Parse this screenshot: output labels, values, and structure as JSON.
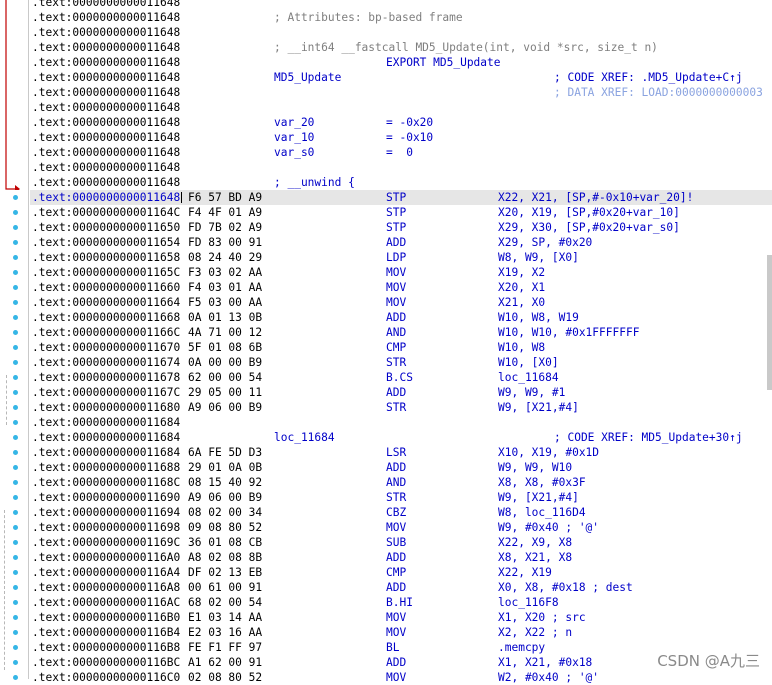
{
  "watermark": "CSDN @A九三",
  "rows": [
    {
      "addr": ".text:0000000000011648",
      "bytes": "",
      "lbl": "",
      "mnem": "",
      "ops": "",
      "cmtGray": "",
      "cmtBlue": "",
      "cmtLBlue": ""
    },
    {
      "addr": ".text:0000000000011648",
      "bytes": "",
      "lbl": "",
      "mnem": "",
      "ops": "",
      "cmtGray": "; Attributes: bp-based frame",
      "cmtBlue": "",
      "cmtLBlue": ""
    },
    {
      "addr": ".text:0000000000011648",
      "bytes": "",
      "lbl": "",
      "mnem": "",
      "ops": "",
      "cmtGray": "",
      "cmtBlue": "",
      "cmtLBlue": ""
    },
    {
      "addr": ".text:0000000000011648",
      "bytes": "",
      "lbl": "",
      "mnem": "",
      "ops": "",
      "cmtGray": "; __int64 __fastcall MD5_Update(int, void *src, size_t n)",
      "cmtBlue": "",
      "cmtLBlue": ""
    },
    {
      "addr": ".text:0000000000011648",
      "bytes": "",
      "lbl": "",
      "mnem": "EXPORT MD5_Update",
      "ops": "",
      "cmtGray": "",
      "cmtBlue": "",
      "cmtLBlue": ""
    },
    {
      "addr": ".text:0000000000011648",
      "bytes": "",
      "lbl": "MD5_Update",
      "mnem": "",
      "ops": "",
      "cmtGray": "",
      "cmtBlue": "; CODE XREF: .MD5_Update+C↑j",
      "cmtLBlue": ""
    },
    {
      "addr": ".text:0000000000011648",
      "bytes": "",
      "lbl": "",
      "mnem": "",
      "ops": "",
      "cmtGray": "",
      "cmtBlue": "",
      "cmtLBlue": "; DATA XREF: LOAD:0000000000003"
    },
    {
      "addr": ".text:0000000000011648",
      "bytes": "",
      "lbl": "",
      "mnem": "",
      "ops": "",
      "cmtGray": "",
      "cmtBlue": "",
      "cmtLBlue": ""
    },
    {
      "addr": ".text:0000000000011648",
      "bytes": "",
      "lbl": "var_20",
      "mnem": "= -0x20",
      "ops": "",
      "cmtGray": "",
      "cmtBlue": "",
      "cmtLBlue": ""
    },
    {
      "addr": ".text:0000000000011648",
      "bytes": "",
      "lbl": "var_10",
      "mnem": "= -0x10",
      "ops": "",
      "cmtGray": "",
      "cmtBlue": "",
      "cmtLBlue": ""
    },
    {
      "addr": ".text:0000000000011648",
      "bytes": "",
      "lbl": "var_s0",
      "mnem": "=  0",
      "ops": "",
      "cmtGray": "",
      "cmtBlue": "",
      "cmtLBlue": ""
    },
    {
      "addr": ".text:0000000000011648",
      "bytes": "",
      "lbl": "",
      "mnem": "",
      "ops": "",
      "cmtGray": "",
      "cmtBlue": "",
      "cmtLBlue": ""
    },
    {
      "addr": ".text:0000000000011648",
      "bytes": "",
      "lbl": "; __unwind {",
      "mnem": "",
      "ops": "",
      "cmtGray": "",
      "cmtBlue": "",
      "cmtLBlue": ""
    },
    {
      "addr": ".text:0000000000011648",
      "bytes": "F6 57 BD A9",
      "lbl": "",
      "mnem": "STP",
      "ops": "X22, X21, [SP,#-0x10+var_20]!",
      "cmtGray": "",
      "cmtBlue": "",
      "cmtLBlue": ""
    },
    {
      "addr": ".text:000000000001164C",
      "bytes": "F4 4F 01 A9",
      "lbl": "",
      "mnem": "STP",
      "ops": "X20, X19, [SP,#0x20+var_10]",
      "cmtGray": "",
      "cmtBlue": "",
      "cmtLBlue": ""
    },
    {
      "addr": ".text:0000000000011650",
      "bytes": "FD 7B 02 A9",
      "lbl": "",
      "mnem": "STP",
      "ops": "X29, X30, [SP,#0x20+var_s0]",
      "cmtGray": "",
      "cmtBlue": "",
      "cmtLBlue": ""
    },
    {
      "addr": ".text:0000000000011654",
      "bytes": "FD 83 00 91",
      "lbl": "",
      "mnem": "ADD",
      "ops": "X29, SP, #0x20",
      "cmtGray": "",
      "cmtBlue": "",
      "cmtLBlue": ""
    },
    {
      "addr": ".text:0000000000011658",
      "bytes": "08 24 40 29",
      "lbl": "",
      "mnem": "LDP",
      "ops": "W8, W9, [X0]",
      "cmtGray": "",
      "cmtBlue": "",
      "cmtLBlue": ""
    },
    {
      "addr": ".text:000000000001165C",
      "bytes": "F3 03 02 AA",
      "lbl": "",
      "mnem": "MOV",
      "ops": "X19, X2",
      "cmtGray": "",
      "cmtBlue": "",
      "cmtLBlue": ""
    },
    {
      "addr": ".text:0000000000011660",
      "bytes": "F4 03 01 AA",
      "lbl": "",
      "mnem": "MOV",
      "ops": "X20, X1",
      "cmtGray": "",
      "cmtBlue": "",
      "cmtLBlue": ""
    },
    {
      "addr": ".text:0000000000011664",
      "bytes": "F5 03 00 AA",
      "lbl": "",
      "mnem": "MOV",
      "ops": "X21, X0",
      "cmtGray": "",
      "cmtBlue": "",
      "cmtLBlue": ""
    },
    {
      "addr": ".text:0000000000011668",
      "bytes": "0A 01 13 0B",
      "lbl": "",
      "mnem": "ADD",
      "ops": "W10, W8, W19",
      "cmtGray": "",
      "cmtBlue": "",
      "cmtLBlue": ""
    },
    {
      "addr": ".text:000000000001166C",
      "bytes": "4A 71 00 12",
      "lbl": "",
      "mnem": "AND",
      "ops": "W10, W10, #0x1FFFFFFF",
      "cmtGray": "",
      "cmtBlue": "",
      "cmtLBlue": ""
    },
    {
      "addr": ".text:0000000000011670",
      "bytes": "5F 01 08 6B",
      "lbl": "",
      "mnem": "CMP",
      "ops": "W10, W8",
      "cmtGray": "",
      "cmtBlue": "",
      "cmtLBlue": ""
    },
    {
      "addr": ".text:0000000000011674",
      "bytes": "0A 00 00 B9",
      "lbl": "",
      "mnem": "STR",
      "ops": "W10, [X0]",
      "cmtGray": "",
      "cmtBlue": "",
      "cmtLBlue": ""
    },
    {
      "addr": ".text:0000000000011678",
      "bytes": "62 00 00 54",
      "lbl": "",
      "mnem": "B.CS",
      "ops": "loc_11684",
      "cmtGray": "",
      "cmtBlue": "",
      "cmtLBlue": ""
    },
    {
      "addr": ".text:000000000001167C",
      "bytes": "29 05 00 11",
      "lbl": "",
      "mnem": "ADD",
      "ops": "W9, W9, #1",
      "cmtGray": "",
      "cmtBlue": "",
      "cmtLBlue": ""
    },
    {
      "addr": ".text:0000000000011680",
      "bytes": "A9 06 00 B9",
      "lbl": "",
      "mnem": "STR",
      "ops": "W9, [X21,#4]",
      "cmtGray": "",
      "cmtBlue": "",
      "cmtLBlue": ""
    },
    {
      "addr": ".text:0000000000011684",
      "bytes": "",
      "lbl": "",
      "mnem": "",
      "ops": "",
      "cmtGray": "",
      "cmtBlue": "",
      "cmtLBlue": ""
    },
    {
      "addr": ".text:0000000000011684",
      "bytes": "",
      "lbl": "loc_11684",
      "mnem": "",
      "ops": "",
      "cmtGray": "",
      "cmtBlue": "; CODE XREF: MD5_Update+30↑j",
      "cmtLBlue": ""
    },
    {
      "addr": ".text:0000000000011684",
      "bytes": "6A FE 5D D3",
      "lbl": "",
      "mnem": "LSR",
      "ops": "X10, X19, #0x1D",
      "cmtGray": "",
      "cmtBlue": "",
      "cmtLBlue": ""
    },
    {
      "addr": ".text:0000000000011688",
      "bytes": "29 01 0A 0B",
      "lbl": "",
      "mnem": "ADD",
      "ops": "W9, W9, W10",
      "cmtGray": "",
      "cmtBlue": "",
      "cmtLBlue": ""
    },
    {
      "addr": ".text:000000000001168C",
      "bytes": "08 15 40 92",
      "lbl": "",
      "mnem": "AND",
      "ops": "X8, X8, #0x3F",
      "cmtGray": "",
      "cmtBlue": "",
      "cmtLBlue": ""
    },
    {
      "addr": ".text:0000000000011690",
      "bytes": "A9 06 00 B9",
      "lbl": "",
      "mnem": "STR",
      "ops": "W9, [X21,#4]",
      "cmtGray": "",
      "cmtBlue": "",
      "cmtLBlue": ""
    },
    {
      "addr": ".text:0000000000011694",
      "bytes": "08 02 00 34",
      "lbl": "",
      "mnem": "CBZ",
      "ops": "W8, loc_116D4",
      "cmtGray": "",
      "cmtBlue": "",
      "cmtLBlue": ""
    },
    {
      "addr": ".text:0000000000011698",
      "bytes": "09 08 80 52",
      "lbl": "",
      "mnem": "MOV",
      "ops": "W9, #0x40 ; '@'",
      "cmtGray": "",
      "cmtBlue": "",
      "cmtLBlue": ""
    },
    {
      "addr": ".text:000000000001169C",
      "bytes": "36 01 08 CB",
      "lbl": "",
      "mnem": "SUB",
      "ops": "X22, X9, X8",
      "cmtGray": "",
      "cmtBlue": "",
      "cmtLBlue": ""
    },
    {
      "addr": ".text:00000000000116A0",
      "bytes": "A8 02 08 8B",
      "lbl": "",
      "mnem": "ADD",
      "ops": "X8, X21, X8",
      "cmtGray": "",
      "cmtBlue": "",
      "cmtLBlue": ""
    },
    {
      "addr": ".text:00000000000116A4",
      "bytes": "DF 02 13 EB",
      "lbl": "",
      "mnem": "CMP",
      "ops": "X22, X19",
      "cmtGray": "",
      "cmtBlue": "",
      "cmtLBlue": ""
    },
    {
      "addr": ".text:00000000000116A8",
      "bytes": "00 61 00 91",
      "lbl": "",
      "mnem": "ADD",
      "ops": "X0, X8, #0x18 ; dest",
      "cmtGray": "",
      "cmtBlue": "",
      "cmtLBlue": ""
    },
    {
      "addr": ".text:00000000000116AC",
      "bytes": "68 02 00 54",
      "lbl": "",
      "mnem": "B.HI",
      "ops": "loc_116F8",
      "cmtGray": "",
      "cmtBlue": "",
      "cmtLBlue": ""
    },
    {
      "addr": ".text:00000000000116B0",
      "bytes": "E1 03 14 AA",
      "lbl": "",
      "mnem": "MOV",
      "ops": "X1, X20 ; src",
      "cmtGray": "",
      "cmtBlue": "",
      "cmtLBlue": ""
    },
    {
      "addr": ".text:00000000000116B4",
      "bytes": "E2 03 16 AA",
      "lbl": "",
      "mnem": "MOV",
      "ops": "X2, X22 ; n",
      "cmtGray": "",
      "cmtBlue": "",
      "cmtLBlue": ""
    },
    {
      "addr": ".text:00000000000116B8",
      "bytes": "FE F1 FF 97",
      "lbl": "",
      "mnem": "BL",
      "ops": ".memcpy",
      "cmtGray": "",
      "cmtBlue": "",
      "cmtLBlue": ""
    },
    {
      "addr": ".text:00000000000116BC",
      "bytes": "A1 62 00 91",
      "lbl": "",
      "mnem": "ADD",
      "ops": "X1, X21, #0x18",
      "cmtGray": "",
      "cmtBlue": "",
      "cmtLBlue": ""
    },
    {
      "addr": ".text:00000000000116C0",
      "bytes": "02 08 80 52",
      "lbl": "",
      "mnem": "MOV",
      "ops": "W2, #0x40 ; '@'",
      "cmtGray": "",
      "cmtBlue": "",
      "cmtLBlue": ""
    }
  ],
  "highlight_row": 13
}
